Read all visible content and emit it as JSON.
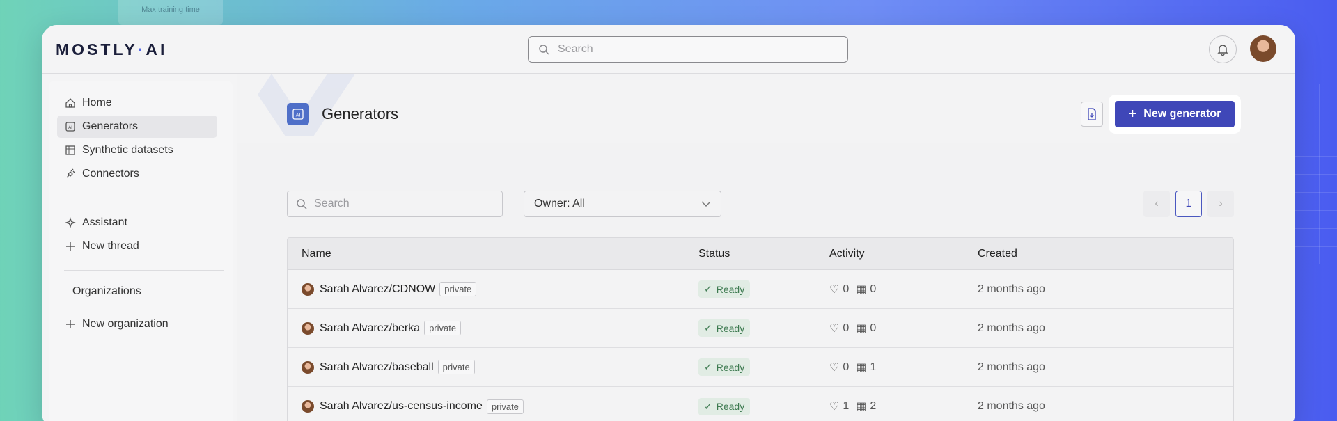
{
  "background_hint": "Max training time",
  "app": {
    "logo_left": "MOSTLY",
    "logo_dot": "·",
    "logo_right": "AI"
  },
  "top_search": {
    "placeholder": "Search"
  },
  "sidebar": {
    "items": [
      {
        "label": "Home",
        "icon": "home-icon"
      },
      {
        "label": "Generators",
        "icon": "generator-icon",
        "active": true
      },
      {
        "label": "Synthetic datasets",
        "icon": "dataset-icon"
      },
      {
        "label": "Connectors",
        "icon": "plug-icon"
      }
    ],
    "assistant": [
      {
        "label": "Assistant",
        "icon": "sparkle-icon"
      },
      {
        "label": "New thread",
        "icon": "plus-icon"
      }
    ],
    "organizations_title": "Organizations",
    "new_org": "New organization"
  },
  "page": {
    "title": "Generators",
    "new_button": "New generator"
  },
  "filters": {
    "search_placeholder": "Search",
    "owner_label": "Owner: All"
  },
  "pager": {
    "current": "1",
    "prev": "‹",
    "next": "›"
  },
  "table": {
    "headers": {
      "name": "Name",
      "status": "Status",
      "activity": "Activity",
      "created": "Created"
    },
    "rows": [
      {
        "name": "Sarah Alvarez/CDNOW",
        "visibility": "private",
        "status": "Ready",
        "likes": "0",
        "datasets": "0",
        "created": "2 months ago"
      },
      {
        "name": "Sarah Alvarez/berka",
        "visibility": "private",
        "status": "Ready",
        "likes": "0",
        "datasets": "0",
        "created": "2 months ago"
      },
      {
        "name": "Sarah Alvarez/baseball",
        "visibility": "private",
        "status": "Ready",
        "likes": "0",
        "datasets": "1",
        "created": "2 months ago"
      },
      {
        "name": "Sarah Alvarez/us-census-income",
        "visibility": "private",
        "status": "Ready",
        "likes": "1",
        "datasets": "2",
        "created": "2 months ago"
      }
    ]
  },
  "colors": {
    "accent": "#3f47b8",
    "ready_bg": "#e1ece4",
    "ready_text": "#3d7a50"
  }
}
